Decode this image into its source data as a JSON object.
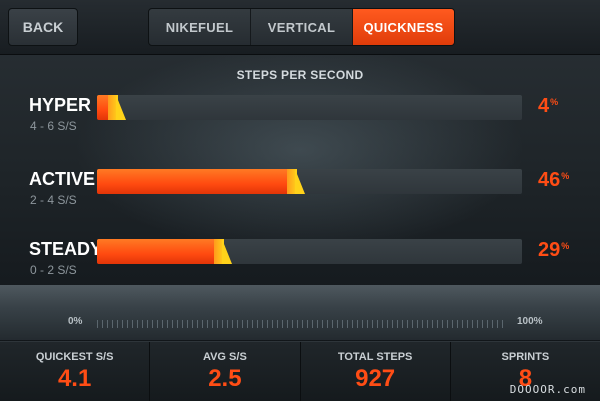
{
  "header": {
    "back_label": "BACK",
    "tabs": [
      {
        "label": "NIKEFUEL",
        "active": false
      },
      {
        "label": "VERTICAL",
        "active": false
      },
      {
        "label": "QUICKNESS",
        "active": true
      }
    ]
  },
  "section_title": "STEPS PER SECOND",
  "rows": [
    {
      "label": "HYPER",
      "range": "4 - 6 S/S",
      "percent": 4,
      "percent_text": "4"
    },
    {
      "label": "ACTIVE",
      "range": "2 - 4 S/S",
      "percent": 46,
      "percent_text": "46"
    },
    {
      "label": "STEADY",
      "range": "0 - 2 S/S",
      "percent": 29,
      "percent_text": "29"
    }
  ],
  "percent_symbol": "%",
  "scale": {
    "min_label": "0%",
    "max_label": "100%"
  },
  "stats": [
    {
      "label": "QUICKEST S/S",
      "value": "4.1"
    },
    {
      "label": "AVG S/S",
      "value": "2.5"
    },
    {
      "label": "TOTAL STEPS",
      "value": "927"
    },
    {
      "label": "SPRINTS",
      "value": "8"
    }
  ],
  "watermark": "DOOOOR.com",
  "colors": {
    "accent": "#ff4d15",
    "bar_tip": "#ffd21a",
    "track": "#343b40"
  }
}
